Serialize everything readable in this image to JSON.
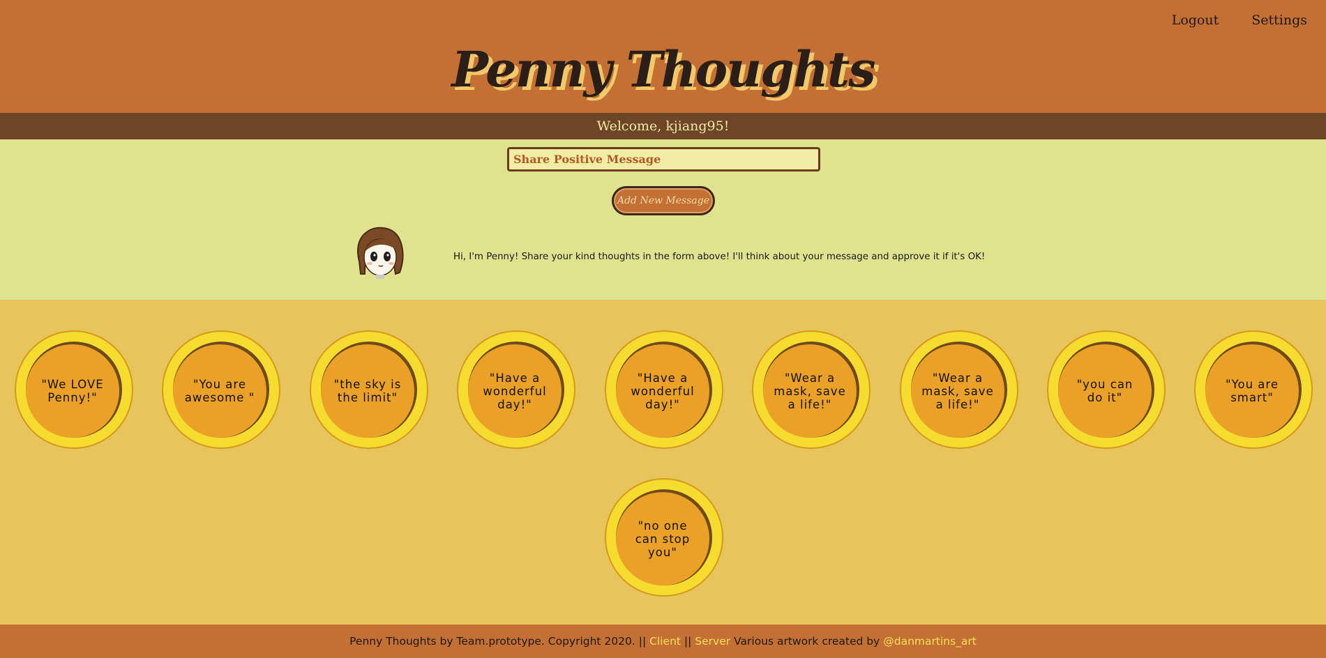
{
  "nav": {
    "logout": "Logout",
    "settings": "Settings"
  },
  "title": "Penny Thoughts",
  "welcome": "Welcome, kjiang95!",
  "compose": {
    "placeholder": "Share Positive Message",
    "button_label": "Add New Message"
  },
  "penny": {
    "message": "Hi, I'm Penny! Share your kind thoughts in the form above! I'll think about your message and approve it if it's OK!",
    "avatar_icon": "penny-avatar-icon"
  },
  "messages": [
    "\"We LOVE Penny!\"",
    "\"You are awesome \"",
    "\"the sky is the limit\"",
    "\"Have a wonderful day!\"",
    "\"Have a wonderful day!\"",
    "\"Wear a mask, save a life!\"",
    "\"Wear a mask, save a life!\"",
    "\"you can do it\"",
    "\"You are smart\"",
    "\"no one can stop you\""
  ],
  "footer": {
    "text_before": "Penny Thoughts by Team.prototype. Copyright 2020. || ",
    "client_link": "Client",
    "separator": " || ",
    "server_link": "Server",
    "text_after": " Various artwork created by ",
    "artist_link": "@danmartins_art"
  },
  "colors": {
    "header": "#c46f33",
    "welcome_bar": "#6d4628",
    "compose_bg": "#dfe38e",
    "coins_bg": "#e8c55c",
    "coin_rim": "#f5dc2f",
    "coin_face": "#eba127",
    "link": "#f5e05a"
  }
}
